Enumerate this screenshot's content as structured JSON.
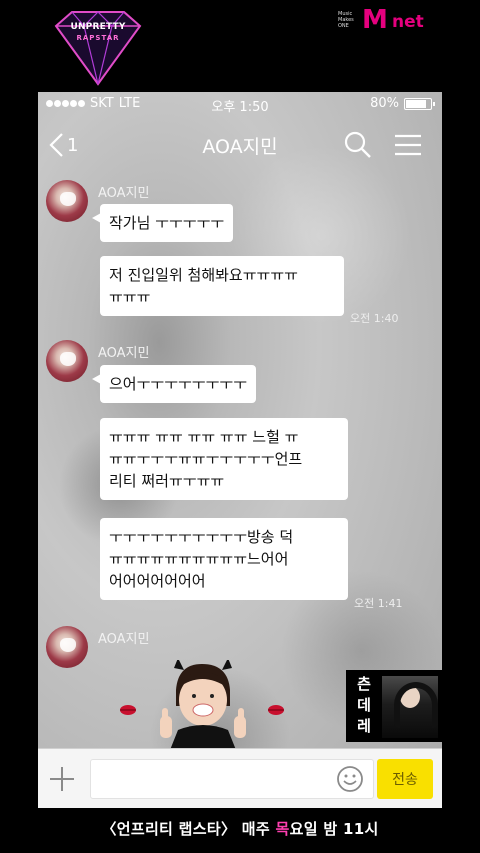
{
  "overlay": {
    "show_logo_title": "UNPRETTY",
    "show_logo_subtitle": "RAPSTAR",
    "channel_tagline": "Music Makes ONE",
    "channel_m": "M",
    "channel_net": "net",
    "caption_prefix": "〈언프리티 랩스타〉 매주 ",
    "caption_highlight": "목",
    "caption_suffix": "요일 밤 11시",
    "inset_text": "츤데레",
    "colors": {
      "brand_pink": "#e5007e",
      "caption_pink": "#ff3fb0"
    }
  },
  "status_bar": {
    "carrier": "SKT",
    "network": "LTE",
    "time": "오후 1:50",
    "battery": "80%"
  },
  "nav": {
    "back_count": "1",
    "title": "AOA지민",
    "icons": [
      "back-chevron-icon",
      "search-icon",
      "menu-icon"
    ]
  },
  "messages": {
    "group1": {
      "sender": "AOA지민",
      "bubble1": "작가님 ㅜㅜㅜㅜㅜ",
      "bubble2": "저 진입일위 첨해봐요ㅠㅠㅠㅠ\nㅠㅠㅠ",
      "time": "오전 1:40"
    },
    "group2": {
      "sender": "AOA지민",
      "bubble1": "으어ㅜㅜㅜㅜㅜㅜㅜㅜ",
      "bubble2": "ㅠㅠㅠ ㅠㅠ ㅠㅠ ㅠㅠ 느헐 ㅠ\nㅠㅠㅜㅜㅜㅠㅠㅜㅜㅜㅜㅜ언프\n리티 쩌러ㅠㅜㅠㅠ",
      "bubble3": "ㅜㅜㅜㅜㅜㅜㅜㅜㅜㅜ방송 덕\nㅠㅠㅠㅠㅠㅠㅠㅠㅠㅠ느어어\n어어어어어어어",
      "time": "오전 1:41"
    },
    "group3": {
      "sender": "AOA지민"
    }
  },
  "input_bar": {
    "placeholder": "",
    "send_label": "전송",
    "colors": {
      "send_bg": "#f9e000"
    }
  }
}
